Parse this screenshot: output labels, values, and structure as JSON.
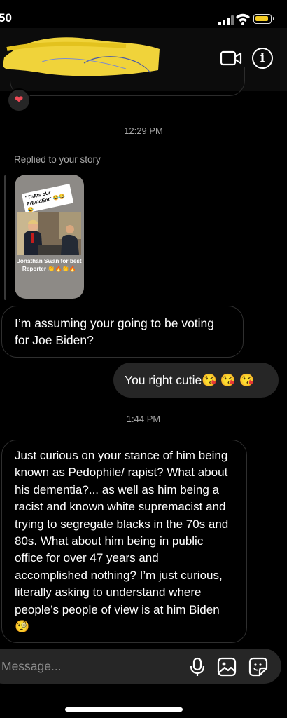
{
  "status_bar": {
    "time": "50"
  },
  "messages": {
    "timestamp_1": "12:29 PM",
    "replied_label": "Replied to your story",
    "story": {
      "sticker_text": "\"ThAts oUr PrEsIdEnt\" 😂😂😂",
      "caption": "Jonathan Swan for best Reporter 👏🔥👏🔥"
    },
    "received_1": "I’m assuming your going to be voting for Joe Biden?",
    "sent_1": "You right cutie😘 😘 😘",
    "timestamp_2": "1:44 PM",
    "received_2": "Just curious on your stance of him being known as Pedophile/ rapist? What about his dementia?... as well as  him being a racist and known white supremacist and trying to segregate blacks in the 70s and 80s. What about him being in public office for over 47 years and accomplished nothing? I’m just curious, literally asking to understand where people’s people of view is at him Biden 🧐"
  },
  "composer": {
    "placeholder": "Message..."
  },
  "icons": [
    "video-call-icon",
    "info-icon",
    "heart-reaction-icon",
    "microphone-icon",
    "gallery-icon",
    "sticker-icon"
  ],
  "colors": {
    "background": "#000000",
    "sent_bubble": "#262626",
    "muted_text": "#a8a8a8",
    "battery": "#f4cc25",
    "redaction": "#f0d33a"
  }
}
